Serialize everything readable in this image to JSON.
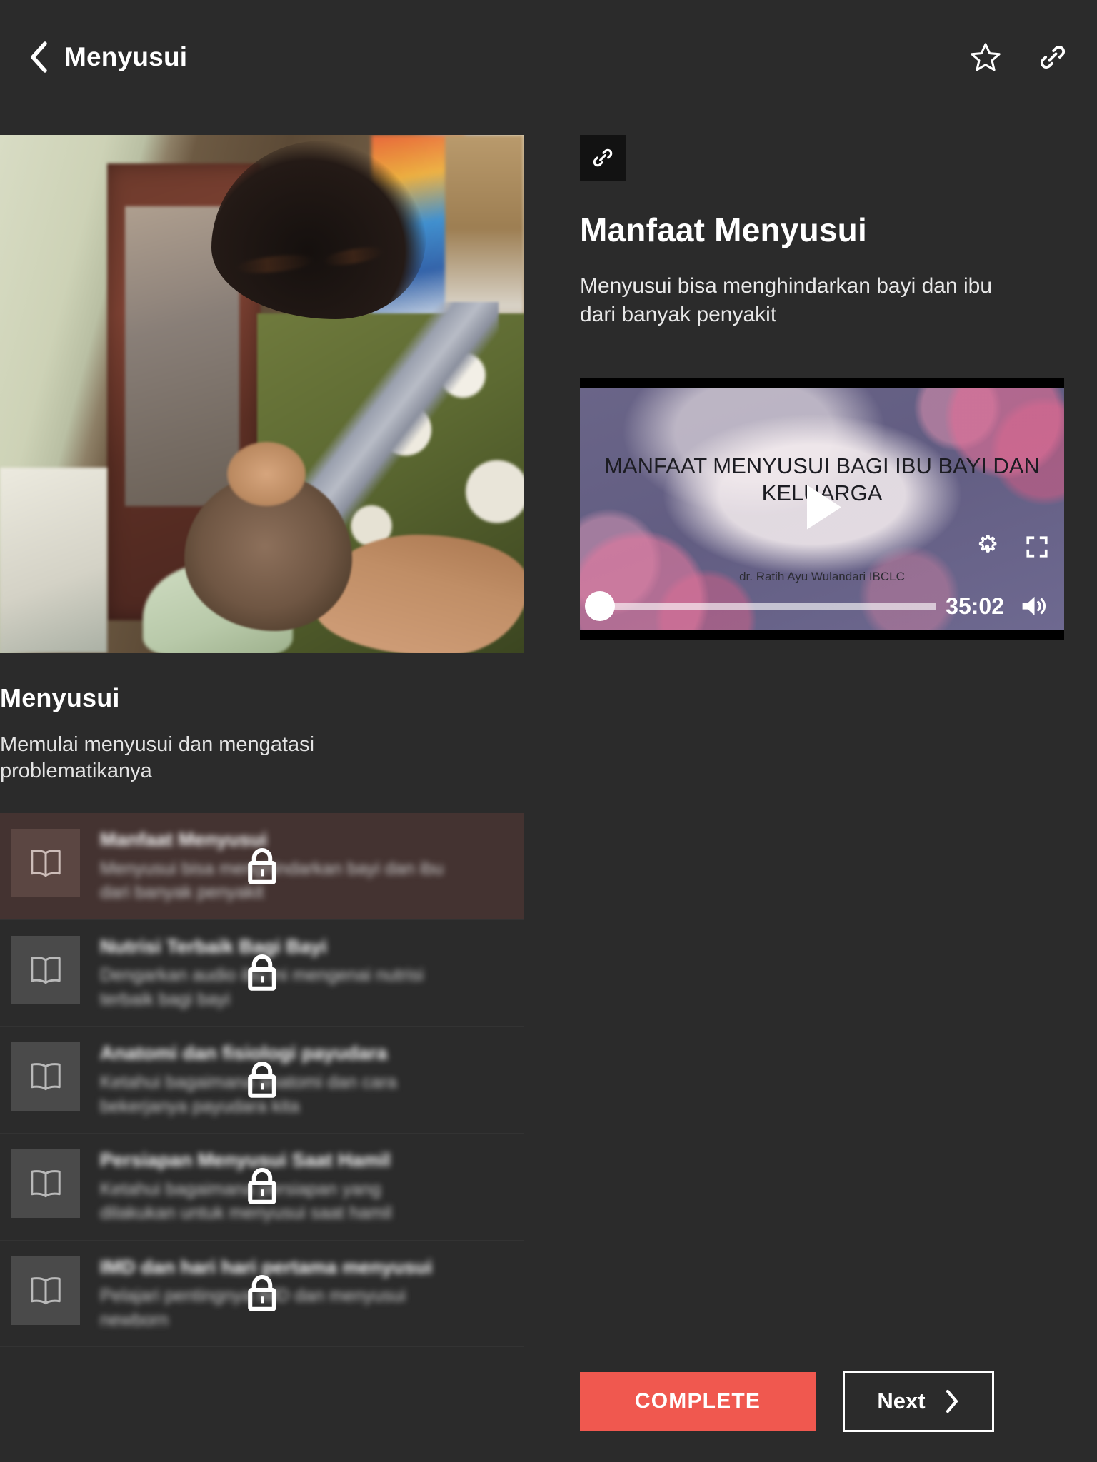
{
  "header": {
    "title": "Menyusui",
    "back_icon": "chevron-left-icon",
    "favorite_icon": "star-outline-icon",
    "share_icon": "link-icon"
  },
  "left_panel": {
    "hero_image_alt": "mother-breastfeeding-baby-photo",
    "title": "Menyusui",
    "subtitle": "Memulai menyusui dan mengatasi problematikanya",
    "lessons": [
      {
        "title": "Manfaat Menyusui",
        "description": "Menyusui bisa menghindarkan bayi dan ibu dari banyak penyakit",
        "locked": true,
        "selected": true,
        "thumb_icon": "book-open-icon",
        "lock_icon": "lock-icon"
      },
      {
        "title": "Nutrisi Terbaik Bagi Bayi",
        "description": "Dengarkan audio ibu ini mengenai nutrisi terbaik bagi bayi",
        "locked": true,
        "selected": false,
        "thumb_icon": "book-open-icon",
        "lock_icon": "lock-icon"
      },
      {
        "title": "Anatomi dan fisiologi payudara",
        "description": "Ketahui bagaimana anatomi dan cara bekerjanya payudara kita",
        "locked": true,
        "selected": false,
        "thumb_icon": "book-open-icon",
        "lock_icon": "lock-icon"
      },
      {
        "title": "Persiapan Menyusui Saat Hamil",
        "description": "Ketahui bagaimana persiapan yang dilakukan untuk menyusui saat hamil",
        "locked": true,
        "selected": false,
        "thumb_icon": "book-open-icon",
        "lock_icon": "lock-icon"
      },
      {
        "title": "IMD dan hari hari pertama menyusui",
        "description": "Pelajari pentingnya IMD dan menyusui newborn",
        "locked": true,
        "selected": false,
        "thumb_icon": "book-open-icon",
        "lock_icon": "lock-icon"
      }
    ]
  },
  "right_panel": {
    "share_chip_icon": "link-icon",
    "title": "Manfaat Menyusui",
    "subtitle": "Menyusui bisa menghindarkan bayi dan ibu dari banyak penyakit",
    "video": {
      "slide_title": "MANFAAT MENYUSUI BAGI IBU BAYI DAN KELUARGA",
      "author": "dr. Ratih Ayu Wulandari IBCLC",
      "duration": "35:02",
      "progress_percent": 0,
      "play_icon": "play-icon",
      "settings_icon": "gear-icon",
      "fullscreen_icon": "fullscreen-icon",
      "volume_icon": "volume-high-icon"
    }
  },
  "footer": {
    "complete_label": "COMPLETE",
    "next_label": "Next",
    "next_icon": "chevron-right-icon"
  },
  "colors": {
    "background": "#2b2b2b",
    "accent_red": "#f0584f",
    "selected_row": "#443331",
    "text_primary": "#ffffff",
    "text_secondary": "#cfcfcf"
  }
}
